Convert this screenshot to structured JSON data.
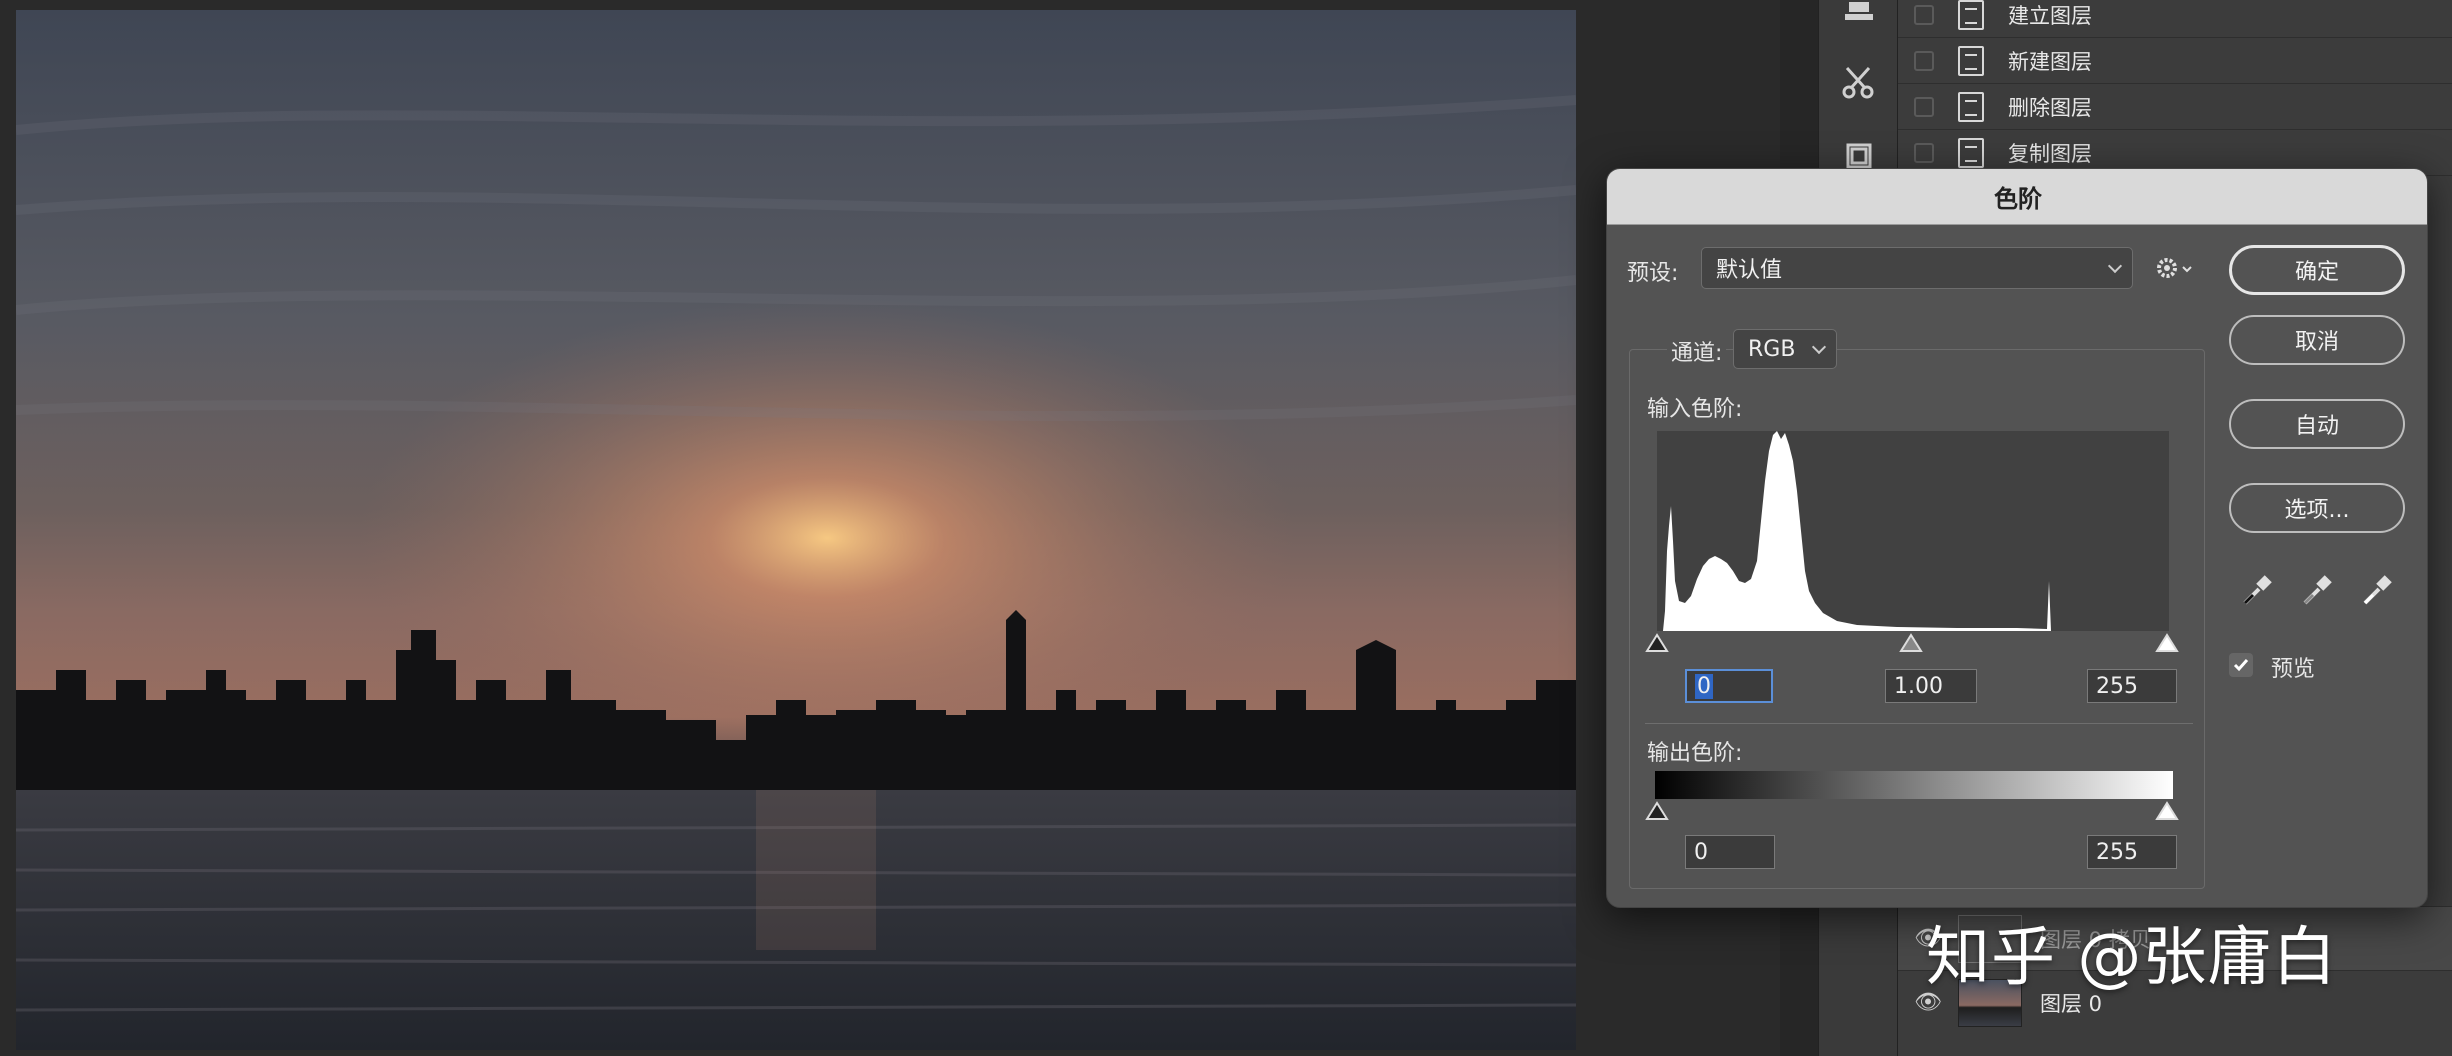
{
  "actions_panel": {
    "items": [
      {
        "label": "建立图层"
      },
      {
        "label": "新建图层"
      },
      {
        "label": "删除图层"
      },
      {
        "label": "复制图层"
      }
    ]
  },
  "layers_panel": {
    "layers": [
      {
        "label": "图层 0 拷贝"
      },
      {
        "label": "图层 0"
      }
    ]
  },
  "watermark": "知乎 @张庸白",
  "dialog": {
    "title": "色阶",
    "preset_label": "预设:",
    "preset_value": "默认值",
    "channel_label": "通道:",
    "channel_value": "RGB",
    "input_levels_label": "输入色阶:",
    "input_black": "0",
    "input_gamma": "1.00",
    "input_white": "255",
    "output_levels_label": "输出色阶:",
    "output_black": "0",
    "output_white": "255",
    "buttons": {
      "ok": "确定",
      "cancel": "取消",
      "auto": "自动",
      "options": "选项..."
    },
    "preview_label": "预览",
    "preview_checked": true
  },
  "colors": {
    "dialog_bg": "#535353",
    "title_bar": "#d9d9d9",
    "panel_bg": "#3c3c3c"
  }
}
